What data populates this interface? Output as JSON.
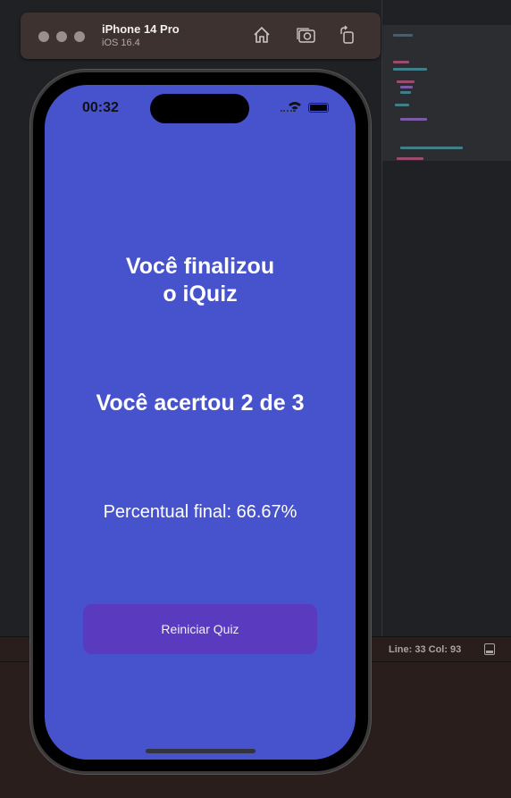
{
  "simulator": {
    "device_name": "iPhone 14 Pro",
    "os_version": "iOS 16.4",
    "toolbar": [
      "home-icon",
      "screenshot-icon",
      "rotate-icon"
    ]
  },
  "editor": {
    "status": "Line: 33  Col: 93"
  },
  "phone": {
    "status_bar": {
      "time": "00:32"
    },
    "title": "Você finalizou o iQuiz",
    "score_text": "Você acertou 2 de 3",
    "percent_text": "Percentual final: 66.67%",
    "restart_button": "Reiniciar Quiz"
  },
  "colors": {
    "screen": "#4753cc",
    "button": "#5a3abf"
  }
}
